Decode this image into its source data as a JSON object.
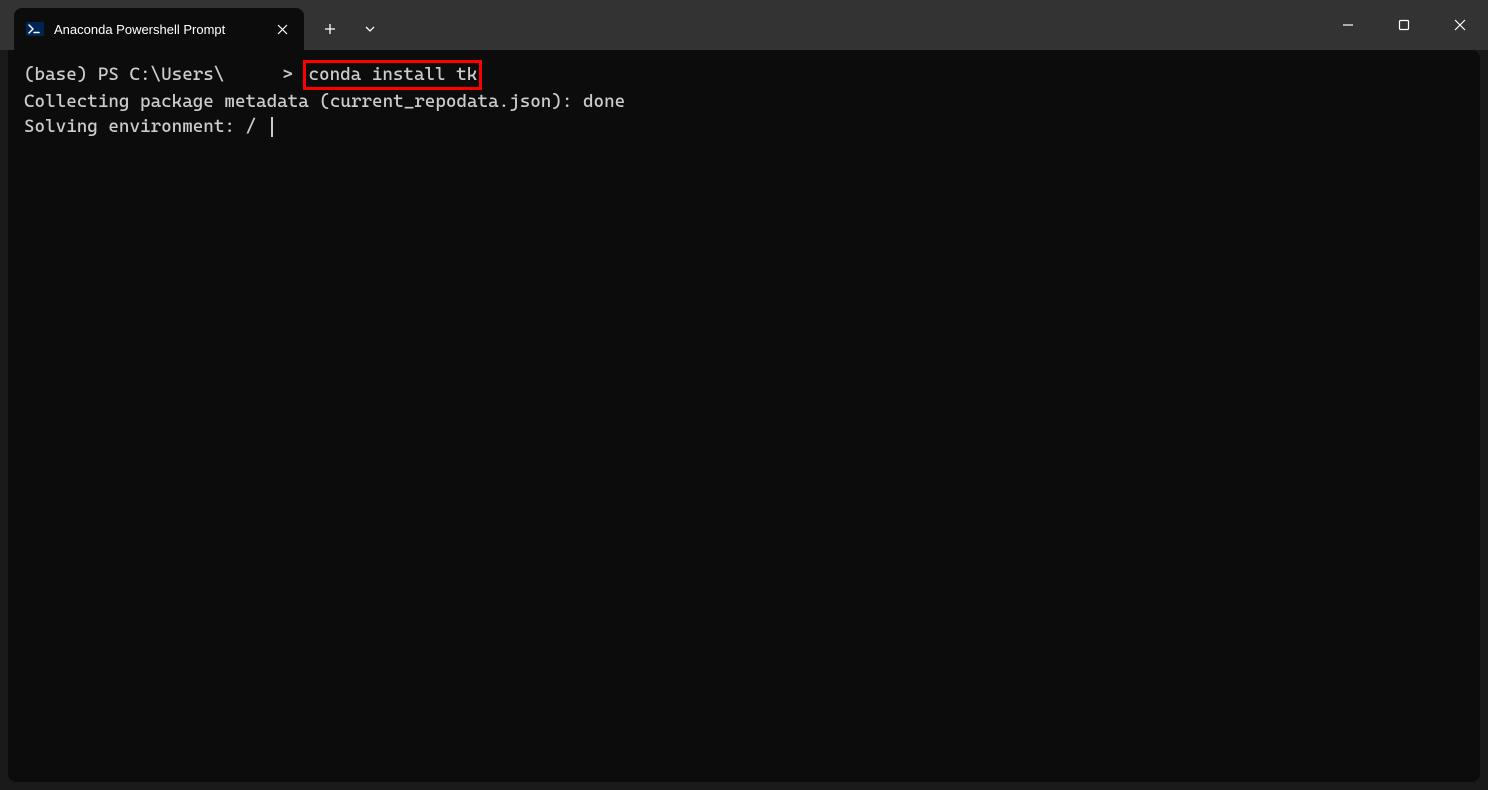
{
  "tab": {
    "title": "Anaconda Powershell Prompt"
  },
  "terminal": {
    "prompt_prefix": "(base) PS C:\\Users\\",
    "prompt_suffix": ">",
    "command": "conda install tk",
    "line2": "Collecting package metadata (current_repodata.json): done",
    "line3": "Solving environment: / "
  }
}
